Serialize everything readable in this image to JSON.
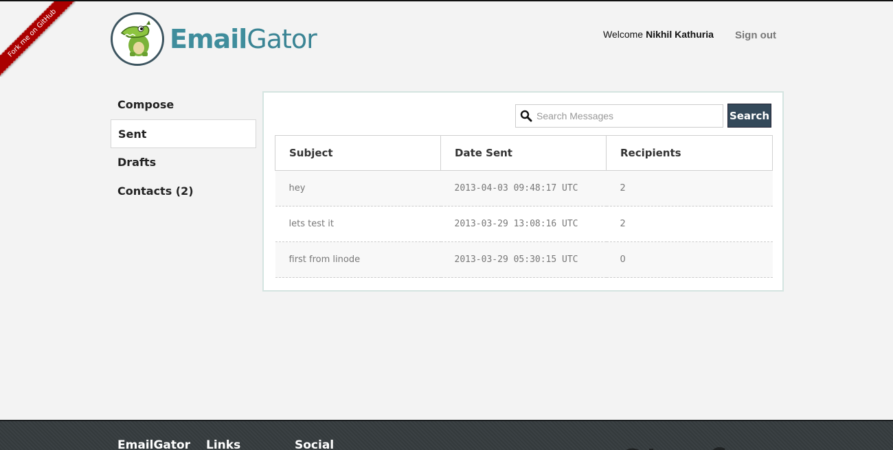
{
  "ribbon": {
    "label": "Fork me on GitHub"
  },
  "brand": {
    "name_bold": "Email",
    "name_light": "Gator"
  },
  "header": {
    "welcome": "Welcome",
    "user_name": "Nikhil Kathuria",
    "sign_out": "Sign out"
  },
  "sidebar": {
    "items": [
      {
        "label": "Compose"
      },
      {
        "label": "Sent"
      },
      {
        "label": "Drafts"
      },
      {
        "label": "Contacts (2)"
      }
    ]
  },
  "search": {
    "placeholder": "Search Messages",
    "button_label": "Search"
  },
  "table": {
    "columns": [
      "Subject",
      "Date Sent",
      "Recipients"
    ],
    "rows": [
      {
        "subject": "hey",
        "date": "2013-04-03 09:48:17 UTC",
        "recipients": "2"
      },
      {
        "subject": "lets test it",
        "date": "2013-03-29 13:08:16 UTC",
        "recipients": "2"
      },
      {
        "subject": "first from linode",
        "date": "2013-03-29 05:30:15 UTC",
        "recipients": "0"
      }
    ]
  },
  "footer": {
    "col1": "EmailGator",
    "col2": "Links",
    "col3": "Social"
  },
  "colors": {
    "accent": "#3f8d9c",
    "button": "#34495a",
    "ribbon": "#aa0000"
  }
}
